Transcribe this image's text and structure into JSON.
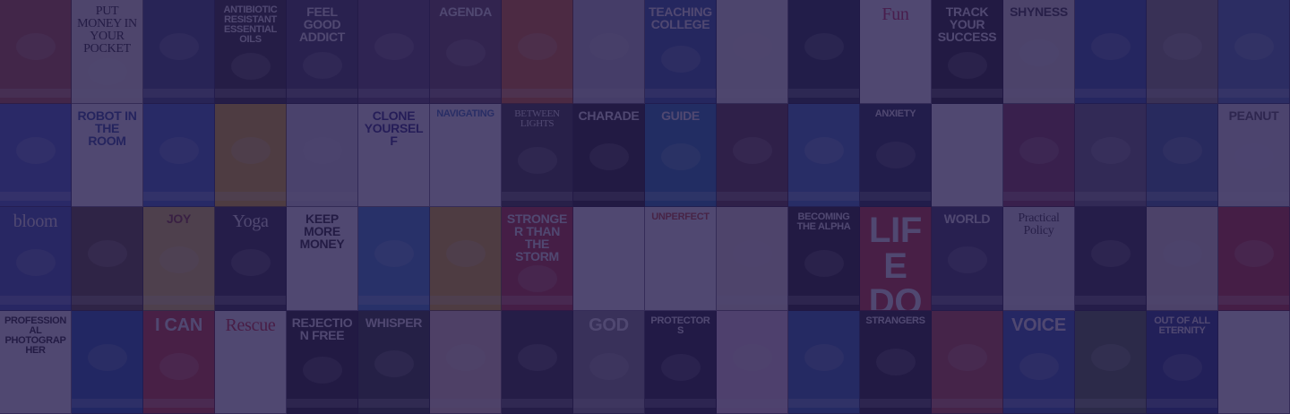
{
  "covers": [
    {
      "t": "",
      "c": "#b8563a"
    },
    {
      "t": "PUT MONEY IN YOUR POCKET",
      "c": "#f3efe6",
      "ink": "#222",
      "s": "serif"
    },
    {
      "t": "",
      "c": "#3a4c7a"
    },
    {
      "t": "ANTIBIOTIC RESISTANT ESSENTIAL OILS",
      "c": "#2a2a2a",
      "s": "small"
    },
    {
      "t": "FEEL GOOD ADDICT",
      "c": "#3d3d55"
    },
    {
      "t": "",
      "c": "#5a4a6a"
    },
    {
      "t": "AGENDA",
      "c": "#6a4a58"
    },
    {
      "t": "",
      "c": "#e86a1c"
    },
    {
      "t": "",
      "c": "#c9c9cf"
    },
    {
      "t": "TEACHING COLLEGE",
      "c": "#2a5aa6"
    },
    {
      "t": "",
      "c": "#f1eee8",
      "ink": "#8a1a1a",
      "s": "serif small"
    },
    {
      "t": "",
      "c": "#1a2a38"
    },
    {
      "t": "Fun",
      "c": "#ffffff",
      "ink": "#d52a4a",
      "s": "serif med"
    },
    {
      "t": "TRACK YOUR SUCCESS",
      "c": "#1a1a1a"
    },
    {
      "t": "SHYNESS",
      "c": "#e8e4dd",
      "ink": "#333"
    },
    {
      "t": "",
      "c": "#2a55a8"
    },
    {
      "t": "",
      "c": "#8a8a7a"
    },
    {
      "t": "",
      "c": "#4a7ab8"
    },
    {
      "t": "",
      "c": "#4466cc"
    },
    {
      "t": "ROBOT IN THE ROOM",
      "c": "#ffffff",
      "ink": "#2a4aa0"
    },
    {
      "t": "",
      "c": "#3a6ac8"
    },
    {
      "t": "",
      "c": "#f2c318"
    },
    {
      "t": "",
      "c": "#e0e0e6"
    },
    {
      "t": "CLONE YOURSELF",
      "c": "#ffffff",
      "ink": "#2a2a80"
    },
    {
      "t": "NAVIGATING",
      "c": "#ffffff",
      "ink": "#3a78c0",
      "s": "small"
    },
    {
      "t": "BETWEEN LIGHTS",
      "c": "#3a3a3a",
      "s": "serif small"
    },
    {
      "t": "CHARADE",
      "c": "#1a1a1a",
      "ink": "#fff"
    },
    {
      "t": "GUIDE",
      "c": "#1a7ab8"
    },
    {
      "t": "",
      "c": "#5a3a3a"
    },
    {
      "t": "",
      "c": "#3b78c8"
    },
    {
      "t": "ANXIETY",
      "c": "#1a2840",
      "s": "small"
    },
    {
      "t": "",
      "c": "#ffffff"
    },
    {
      "t": "",
      "c": "#8a3a4a"
    },
    {
      "t": "",
      "c": "#6a6a7a"
    },
    {
      "t": "",
      "c": "#3a6aa0"
    },
    {
      "t": "PEANUT",
      "c": "#e8e8f0",
      "ink": "#555"
    },
    {
      "t": "bloom",
      "c": "#3a5ab8",
      "s": "serif med"
    },
    {
      "t": "",
      "c": "#5a4a2a"
    },
    {
      "t": "JOY",
      "c": "#f3d54a",
      "ink": "#8a3a1a"
    },
    {
      "t": "Yoga",
      "c": "#2a2a3a",
      "s": "serif med"
    },
    {
      "t": "KEEP MORE MONEY",
      "c": "#ffffff",
      "ink": "#222"
    },
    {
      "t": "",
      "c": "#3a8ad8"
    },
    {
      "t": "",
      "c": "#f2c018"
    },
    {
      "t": "STRONGER THAN THE STORM",
      "c": "#c8302a"
    },
    {
      "t": "",
      "c": "#ffffff",
      "ink": "#222"
    },
    {
      "t": "UNPERFECT",
      "c": "#ffffff",
      "ink": "#d04a2a",
      "s": "small"
    },
    {
      "t": "",
      "c": "#f2e8e0",
      "ink": "#c02a5a"
    },
    {
      "t": "BECOMING THE ALPHA",
      "c": "#1a1a1a",
      "s": "small"
    },
    {
      "t": "LIFE DOC",
      "c": "#d8342a",
      "s": "big"
    },
    {
      "t": "WORLD",
      "c": "#3a3a5a"
    },
    {
      "t": "Practical Policy",
      "c": "#e8e8ee",
      "ink": "#333",
      "s": "serif"
    },
    {
      "t": "",
      "c": "#2a2a38"
    },
    {
      "t": "",
      "c": "#e8e0d8"
    },
    {
      "t": "",
      "c": "#c8302a"
    },
    {
      "t": "PROFESSIONAL PHOTOGRAPHER",
      "c": "#ffffff",
      "ink": "#222",
      "s": "small"
    },
    {
      "t": "",
      "c": "#1a5ab8"
    },
    {
      "t": "I CAN",
      "c": "#d83a2a",
      "s": "med"
    },
    {
      "t": "Rescue",
      "c": "#ffffff",
      "ink": "#d82a2a",
      "s": "serif med"
    },
    {
      "t": "REJECTION FREE",
      "c": "#1a1a1a"
    },
    {
      "t": "WHISPER",
      "c": "#2a3a2a"
    },
    {
      "t": "",
      "c": "#f2d8c8"
    },
    {
      "t": "",
      "c": "#2a2a30"
    },
    {
      "t": "GOD",
      "c": "#8a8a8a",
      "s": "med"
    },
    {
      "t": "PROTECTORS",
      "c": "#1a1a2a",
      "s": "small"
    },
    {
      "t": "",
      "c": "#f2d8e8"
    },
    {
      "t": "",
      "c": "#2a6ab8"
    },
    {
      "t": "STRANGERS",
      "c": "#1a1a20",
      "s": "small"
    },
    {
      "t": "",
      "c": "#c84a3a"
    },
    {
      "t": "VOICE",
      "c": "#2a5ab8",
      "s": "med"
    },
    {
      "t": "",
      "c": "#4a6a3a"
    },
    {
      "t": "OUT OF ALL ETERNITY",
      "c": "#1a3a88",
      "s": "small"
    },
    {
      "t": "",
      "c": "#ffffff",
      "ink": "#c82a2a"
    }
  ]
}
